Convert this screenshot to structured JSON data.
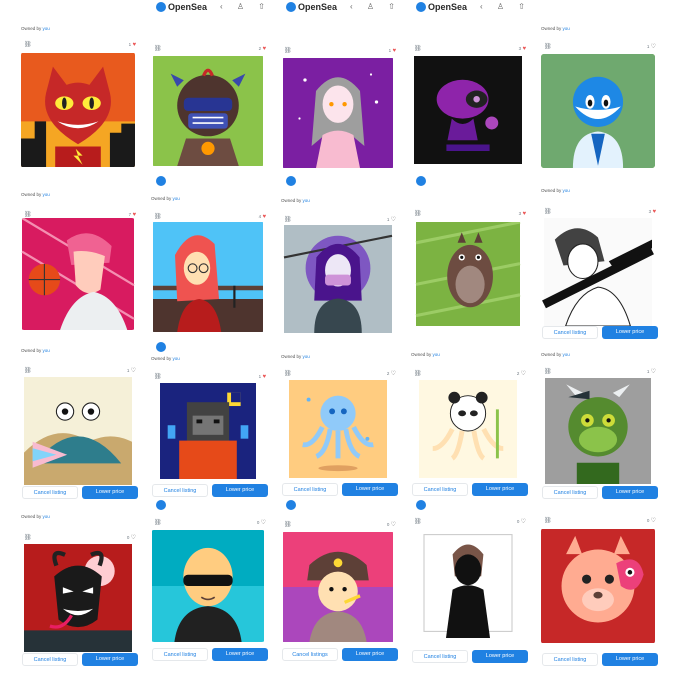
{
  "app": {
    "name": "OpenSea",
    "header_icons": "‹ ♙ ⇧"
  },
  "owned": {
    "prefix": "Owned by",
    "user": "you"
  },
  "buttons": {
    "cancel": "Cancel listing",
    "cancel_plural": "Cancel listings",
    "lower": "Lower price"
  },
  "colors": {
    "accent": "#2081e2",
    "heart": "#eb5757"
  },
  "cards": [
    {
      "id": "c11",
      "likes": "1",
      "heart": "filled",
      "art": "flash-cat"
    },
    {
      "id": "c12",
      "likes": "2",
      "heart": "filled",
      "art": "masked-monkey"
    },
    {
      "id": "c13",
      "likes": "1",
      "heart": "filled",
      "art": "anime-girl-purple"
    },
    {
      "id": "c14",
      "likes": "3",
      "heart": "filled",
      "art": "purple-robot"
    },
    {
      "id": "c15",
      "likes": "1",
      "heart": "empty",
      "art": "blue-toy"
    },
    {
      "id": "c21",
      "likes": "7",
      "heart": "filled",
      "art": "basketball-boy"
    },
    {
      "id": "c22",
      "likes": "4",
      "heart": "filled",
      "art": "redhead-glasses"
    },
    {
      "id": "c23",
      "likes": "1",
      "heart": "empty",
      "art": "masked-ninja-girl"
    },
    {
      "id": "c24",
      "likes": "3",
      "heart": "filled",
      "art": "totoro-green"
    },
    {
      "id": "c25",
      "likes": "3",
      "heart": "filled",
      "art": "manga-swordsman"
    },
    {
      "id": "c31",
      "likes": "1",
      "heart": "empty",
      "art": "crab-fan"
    },
    {
      "id": "c32",
      "likes": "1",
      "heart": "filled",
      "art": "pixel-gorilla"
    },
    {
      "id": "c33",
      "likes": "2",
      "heart": "empty",
      "art": "blue-octopus"
    },
    {
      "id": "c34",
      "likes": "2",
      "heart": "empty",
      "art": "panda-octopus"
    },
    {
      "id": "c35",
      "likes": "1",
      "heart": "empty",
      "art": "green-ape"
    },
    {
      "id": "c41",
      "likes": "0",
      "heart": "empty",
      "art": "venom-goat"
    },
    {
      "id": "c42",
      "likes": "0",
      "heart": "empty",
      "art": "bald-sunglasses"
    },
    {
      "id": "c43",
      "likes": "0",
      "heart": "empty",
      "art": "soviet-hat"
    },
    {
      "id": "c44",
      "likes": "0",
      "heart": "empty",
      "art": "silhouette-boy"
    },
    {
      "id": "c45",
      "likes": "0",
      "heart": "empty",
      "art": "llama-monster"
    }
  ]
}
